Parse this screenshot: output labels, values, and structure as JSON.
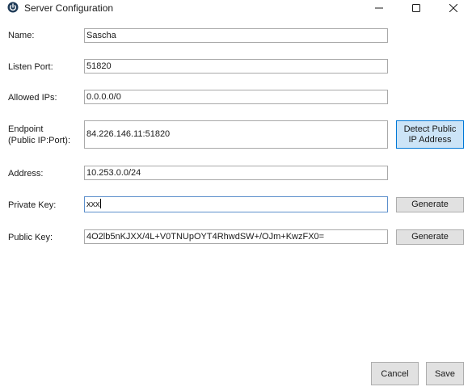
{
  "window": {
    "title": "Server Configuration",
    "app_icon": "power-icon",
    "controls": {
      "minimize": "minimize-icon",
      "maximize": "maximize-icon",
      "close": "close-icon"
    }
  },
  "form": {
    "name": {
      "label": "Name:",
      "value": "Sascha"
    },
    "listen_port": {
      "label": "Listen Port:",
      "value": "51820"
    },
    "allowed_ips": {
      "label": "Allowed IPs:",
      "value": "0.0.0.0/0"
    },
    "endpoint": {
      "label_line1": "Endpoint",
      "label_line2": "(Public IP:Port):",
      "value": "84.226.146.11:51820",
      "detect_button_line1": "Detect Public",
      "detect_button_line2": "IP Address"
    },
    "address": {
      "label": "Address:",
      "value": "10.253.0.0/24"
    },
    "private_key": {
      "label": "Private Key:",
      "value": "xxx",
      "generate_label": "Generate"
    },
    "public_key": {
      "label": "Public Key:",
      "value": "4O2lb5nKJXX/4L+V0TNUpOYT4RhwdSW+/OJm+KwzFX0=",
      "generate_label": "Generate"
    }
  },
  "footer": {
    "cancel_label": "Cancel",
    "save_label": "Save"
  },
  "colors": {
    "accent_button_bg": "#cce4f7",
    "accent_button_border": "#0078d7",
    "focused_field_border": "#5c8fcc"
  }
}
